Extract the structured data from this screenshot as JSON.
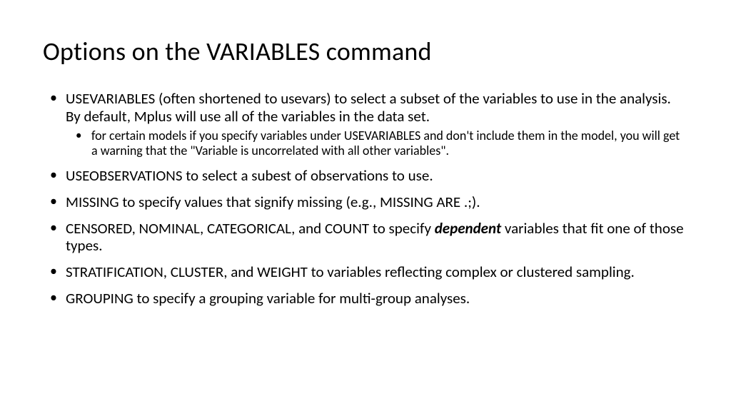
{
  "title": "Options on the VARIABLES command",
  "bullets": {
    "b1": "USEVARIABLES (often shortened to usevars) to select a subset of the variables to use in the analysis.  By default, Mplus will use all of the variables in the data set.",
    "b1_sub": "for certain models if you specify variables under USEVARIABLES and don't include them in the model, you will get a warning that the \"Variable is uncorrelated with all other variables\".",
    "b2": "USEOBSERVATIONS to select a subest of observations to use.",
    "b3": "MISSING to specify values that signify missing (e.g., MISSING ARE .;).",
    "b4_pre": "CENSORED, NOMINAL, CATEGORICAL, and COUNT to specify ",
    "b4_em": "dependent",
    "b4_post": " variables that fit one of those types.",
    "b5": "STRATIFICATION, CLUSTER, and WEIGHT to variables reflecting complex or clustered sampling.",
    "b6": "GROUPING to specify a grouping variable for multi-group analyses."
  }
}
